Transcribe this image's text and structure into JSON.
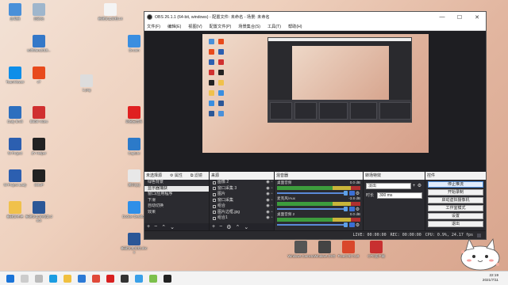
{
  "desktop": {
    "icons": [
      {
        "label": "此电脑",
        "color": "#4a90d9"
      },
      {
        "label": "回收站",
        "color": "#9fb6cc"
      },
      {
        "label": "新建文本文档.txt",
        "color": "#f4f4f4"
      },
      {
        "label": "softWare2019...",
        "color": "#3478c8"
      },
      {
        "label": "TeamViewer",
        "color": "#0e8ee9"
      },
      {
        "label": "v7",
        "color": "#e84a1c"
      },
      {
        "label": "1.png",
        "color": "#dddddd"
      },
      {
        "label": "Daily Emili",
        "color": "#2d6fbf"
      },
      {
        "label": "Bilibili Video",
        "color": "#d03030"
      },
      {
        "label": "W Project",
        "color": "#2c5fb0"
      },
      {
        "label": "ZY Helper",
        "color": "#222222"
      },
      {
        "label": "W Project Lady",
        "color": "#2c5fb0"
      },
      {
        "label": "SOUP",
        "color": "#222222"
      },
      {
        "label": "新建文件夹",
        "color": "#f0c14b"
      },
      {
        "label": "新建文本文档(2).docx",
        "color": "#2b5797"
      },
      {
        "label": "Dr.com",
        "color": "#3a8ee0"
      },
      {
        "label": "网易云音乐",
        "color": "#e02020"
      },
      {
        "label": "Capture",
        "color": "#2c7ac9"
      },
      {
        "label": "腾讯QQ",
        "color": "#e8e8e8"
      },
      {
        "label": "Docker Desktop",
        "color": "#2f8fe8"
      },
      {
        "label": "新建文本文档.docx",
        "color": "#2b5797"
      },
      {
        "label": "Windows Camera",
        "color": "#555555"
      },
      {
        "label": "Windows DVD",
        "color": "#444444"
      },
      {
        "label": "FreeCAD 0.19",
        "color": "#d9472b"
      },
      {
        "label": "CPC客户端",
        "color": "#c83030"
      }
    ]
  },
  "obs": {
    "title": "OBS 26.1.1 (64-bit, windows) - 配置文件: 未命名 - 场景: 未命名",
    "window_controls": {
      "minimize": "—",
      "maximize": "☐",
      "close": "✕"
    },
    "menu": [
      "文件(F)",
      "编辑(E)",
      "视图(V)",
      "配置文件(P)",
      "场景集合(S)",
      "工具(T)",
      "帮助(H)"
    ],
    "scenes": {
      "header": "未选择源",
      "props_label": "属性",
      "filter_label": "滤镜",
      "items": [
        "绿色背景",
        "显示器捕获",
        "窗口/应用程序",
        "下滑",
        "自动切换",
        "效果"
      ],
      "selected_index": 1
    },
    "sources": {
      "header": "来源",
      "items": [
        "图像 2",
        "窗口采集 3",
        "图片",
        "窗口采集",
        "组合",
        "图片边框.jpg",
        "组合1"
      ]
    },
    "mixer": {
      "header": "混音器",
      "channels": [
        {
          "name": "桌面音频",
          "level": "0.0 dB"
        },
        {
          "name": "麦克风/Aux",
          "level": "-3.8 dB"
        },
        {
          "name": "桌面音频 2",
          "level": "0.0 dB"
        }
      ]
    },
    "transitions": {
      "header": "转场特效",
      "type": "淡出",
      "duration_label": "时长",
      "duration": "300 ms"
    },
    "controls": {
      "header": "控件",
      "buttons": [
        "停止推流",
        "开始录制",
        "启动虚拟摄像机",
        "工作室模式",
        "设置",
        "退出"
      ]
    },
    "status": {
      "live": "LIVE: 00:00:00",
      "rec": "REC: 00:00:00",
      "cpu": "CPU: 0.9%, 24.17 fps"
    }
  },
  "taskbar": {
    "icons": [
      {
        "name": "start",
        "color": "#1a74d8"
      },
      {
        "name": "search",
        "color": "#cccccc"
      },
      {
        "name": "task-view",
        "color": "#bbbbbb"
      },
      {
        "name": "edge",
        "color": "#1b9de2"
      },
      {
        "name": "explorer",
        "color": "#f0c040"
      },
      {
        "name": "store",
        "color": "#2c7ad6"
      },
      {
        "name": "chrome",
        "color": "#e04a3a"
      },
      {
        "name": "netease",
        "color": "#d82020"
      },
      {
        "name": "obs",
        "color": "#333333"
      },
      {
        "name": "tencent",
        "color": "#3aa0e8"
      },
      {
        "name": "android",
        "color": "#7cc04b"
      },
      {
        "name": "obs2",
        "color": "#222222"
      }
    ],
    "time": "22:19",
    "date": "2021/7/11"
  }
}
